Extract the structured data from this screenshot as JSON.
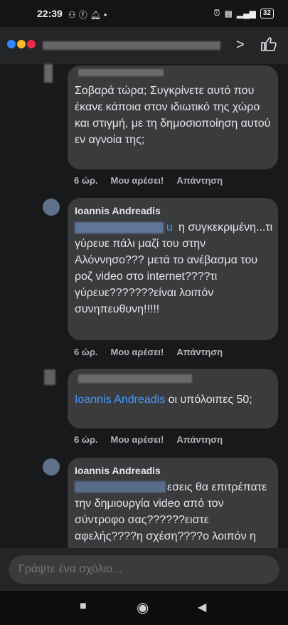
{
  "status": {
    "time": "22:39",
    "left_icons": [
      "messenger-icon",
      "facebook-icon",
      "notification-icon",
      "dot"
    ],
    "right_icons": [
      "alarm-icon",
      "volte-icon",
      "signal-icon"
    ],
    "battery": "32"
  },
  "comments": [
    {
      "author": "",
      "text": "Σοβαρά τώρα; Συγκρίνετε αυτό που έκανε κάποια στον ιδιωτικό της χώρο και στιγμή, με τη δημοσιοποίηση αυτού εν αγνοία της;",
      "time": "6 ώρ.",
      "like": "Μου αρέσει!",
      "reply": "Απάντηση"
    },
    {
      "author": "Ioannis Andreadis",
      "mention_suffix": "u",
      "text": "η συγκεκριμένη...τι γύρευε πάλι μαζί του στην Αλόννησο??? μετά το ανέβασμα του ροζ video στο internet????τι γύρευε???????είναι λοιπόν συνηπευθυνη!!!!!",
      "time": "6 ώρ.",
      "like": "Μου αρέσει!",
      "reply": "Απάντηση"
    },
    {
      "author": "",
      "mention": "Ioannis Andreadis",
      "text": "οι υπόλοιπες 50;",
      "time": "6 ώρ.",
      "like": "Μου αρέσει!",
      "reply": "Απάντηση"
    },
    {
      "author": "Ioannis Andreadis",
      "text": "εσεις θα επιτρέπατε την δημιουργία video από τον σύντροφο σας??????ειστε αφελής????η σχέση????ο λοιπόν η",
      "time": "",
      "like": "",
      "reply": ""
    }
  ],
  "composer": {
    "placeholder": "Γράψτε ένα σχόλιο..."
  },
  "nav": {
    "recents": "■",
    "home": "◉",
    "back": "◀"
  }
}
